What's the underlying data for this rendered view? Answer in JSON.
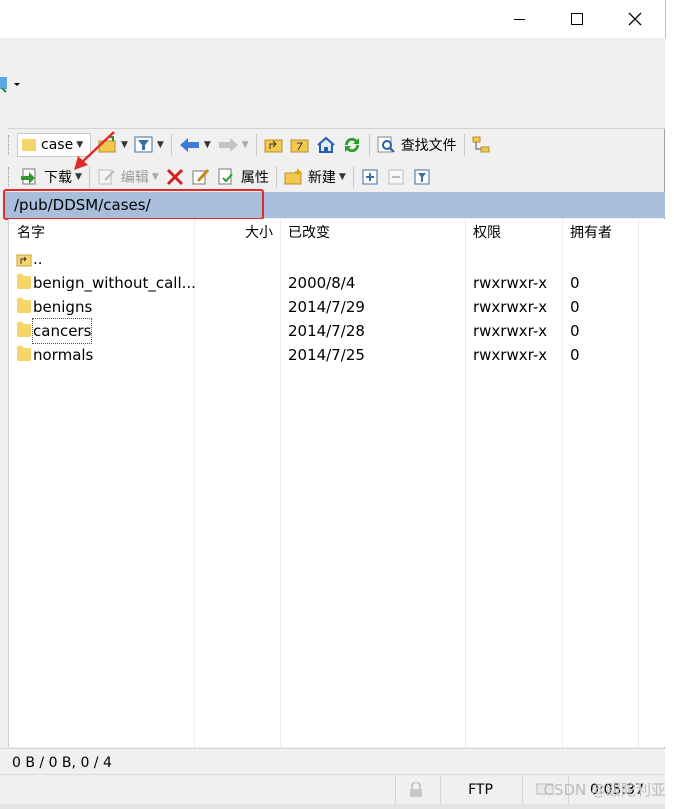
{
  "window": {
    "controls": [
      "minimize",
      "maximize",
      "close"
    ]
  },
  "toolbar1": {
    "location_combo": "case",
    "find_files_label": "查找文件"
  },
  "toolbar2": {
    "download_label": "下载",
    "edit_label": "编辑",
    "properties_label": "属性",
    "new_label": "新建"
  },
  "path": "/pub/DDSM/cases/",
  "columns": {
    "name": "名字",
    "size": "大小",
    "modified": "已改变",
    "permissions": "权限",
    "owner": "拥有者"
  },
  "files": [
    {
      "name": "..",
      "modified": "",
      "permissions": "",
      "owner": "",
      "type": "parent"
    },
    {
      "name": "benign_without_call...",
      "modified": "2000/8/4",
      "permissions": "rwxrwxr-x",
      "owner": "0",
      "type": "folder"
    },
    {
      "name": "benigns",
      "modified": "2014/7/29",
      "permissions": "rwxrwxr-x",
      "owner": "0",
      "type": "folder"
    },
    {
      "name": "cancers",
      "modified": "2014/7/28",
      "permissions": "rwxrwxr-x",
      "owner": "0",
      "type": "folder"
    },
    {
      "name": "normals",
      "modified": "2014/7/25",
      "permissions": "rwxrwxr-x",
      "owner": "0",
      "type": "folder"
    }
  ],
  "status": {
    "summary": "0 B / 0 B,  0 / 4",
    "protocol": "FTP",
    "time": "0:05:37"
  },
  "watermark": "CSDN @跋陀利亚",
  "colors": {
    "path_bar": "#a9bedb",
    "highlight_box": "#e02b2b",
    "folder": "#f7d56a"
  }
}
